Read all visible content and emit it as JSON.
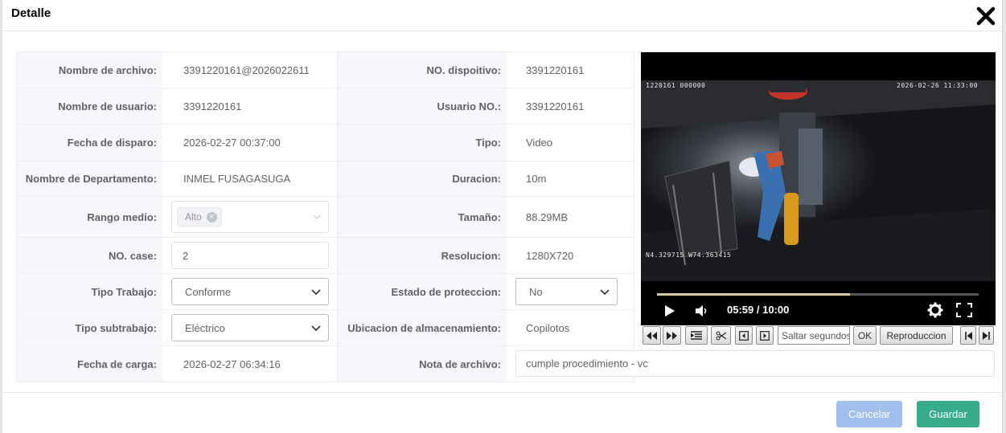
{
  "dialog": {
    "title": "Detalle"
  },
  "fields": {
    "nombre_archivo": {
      "label": "Nombre de archivo:",
      "value": "3391220161@2026022611"
    },
    "nombre_usuario": {
      "label": "Nombre de usuario:",
      "value": "3391220161"
    },
    "fecha_disparo": {
      "label": "Fecha de disparo:",
      "value": "2026-02-27 00:37:00"
    },
    "departamento": {
      "label": "Nombre de Departamento:",
      "value": "INMEL FUSAGASUGA"
    },
    "rango_medio": {
      "label": "Rango medio:",
      "tag": "Alto"
    },
    "no_case": {
      "label": "NO. case:",
      "value": "2"
    },
    "tipo_trabajo": {
      "label": "Tipo Trabajo:",
      "value": "Conforme"
    },
    "tipo_subtrabajo": {
      "label": "Tipo subtrabajo:",
      "value": "Eléctrico"
    },
    "fecha_carga": {
      "label": "Fecha de carga:",
      "value": "2026-02-27 06:34:16"
    },
    "no_dispositivo": {
      "label": "NO. dispoitivo:",
      "value": "3391220161"
    },
    "usuario_no": {
      "label": "Usuario NO.:",
      "value": "3391220161"
    },
    "tipo": {
      "label": "Tipo:",
      "value": "Video"
    },
    "duracion": {
      "label": "Duracion:",
      "value": "10m"
    },
    "tamano": {
      "label": "Tamaño:",
      "value": "88.29MB"
    },
    "resolucion": {
      "label": "Resolucion:",
      "value": "1280X720"
    },
    "estado_proteccion": {
      "label": "Estado de proteccion:",
      "value": "No"
    },
    "ubicacion": {
      "label": "Ubicacion de almacenamiento:",
      "value": "Copilotos"
    },
    "nota_archivo": {
      "label": "Nota de archivo:",
      "value": "cumple procedimiento - vc"
    }
  },
  "video": {
    "osd_top_left": "1220161 000000",
    "osd_top_right": "2026-02-26  11:33:00",
    "osd_bottom_left": "N4.329715  W74.363415",
    "time": "05:59 / 10:00",
    "progress": 0.599
  },
  "toolbar": {
    "skip_placeholder": "Saltar segundos",
    "ok_label": "OK",
    "playback_label": "Reproduccion"
  },
  "buttons": {
    "cancel": "Cancelar",
    "save": "Guardar"
  }
}
